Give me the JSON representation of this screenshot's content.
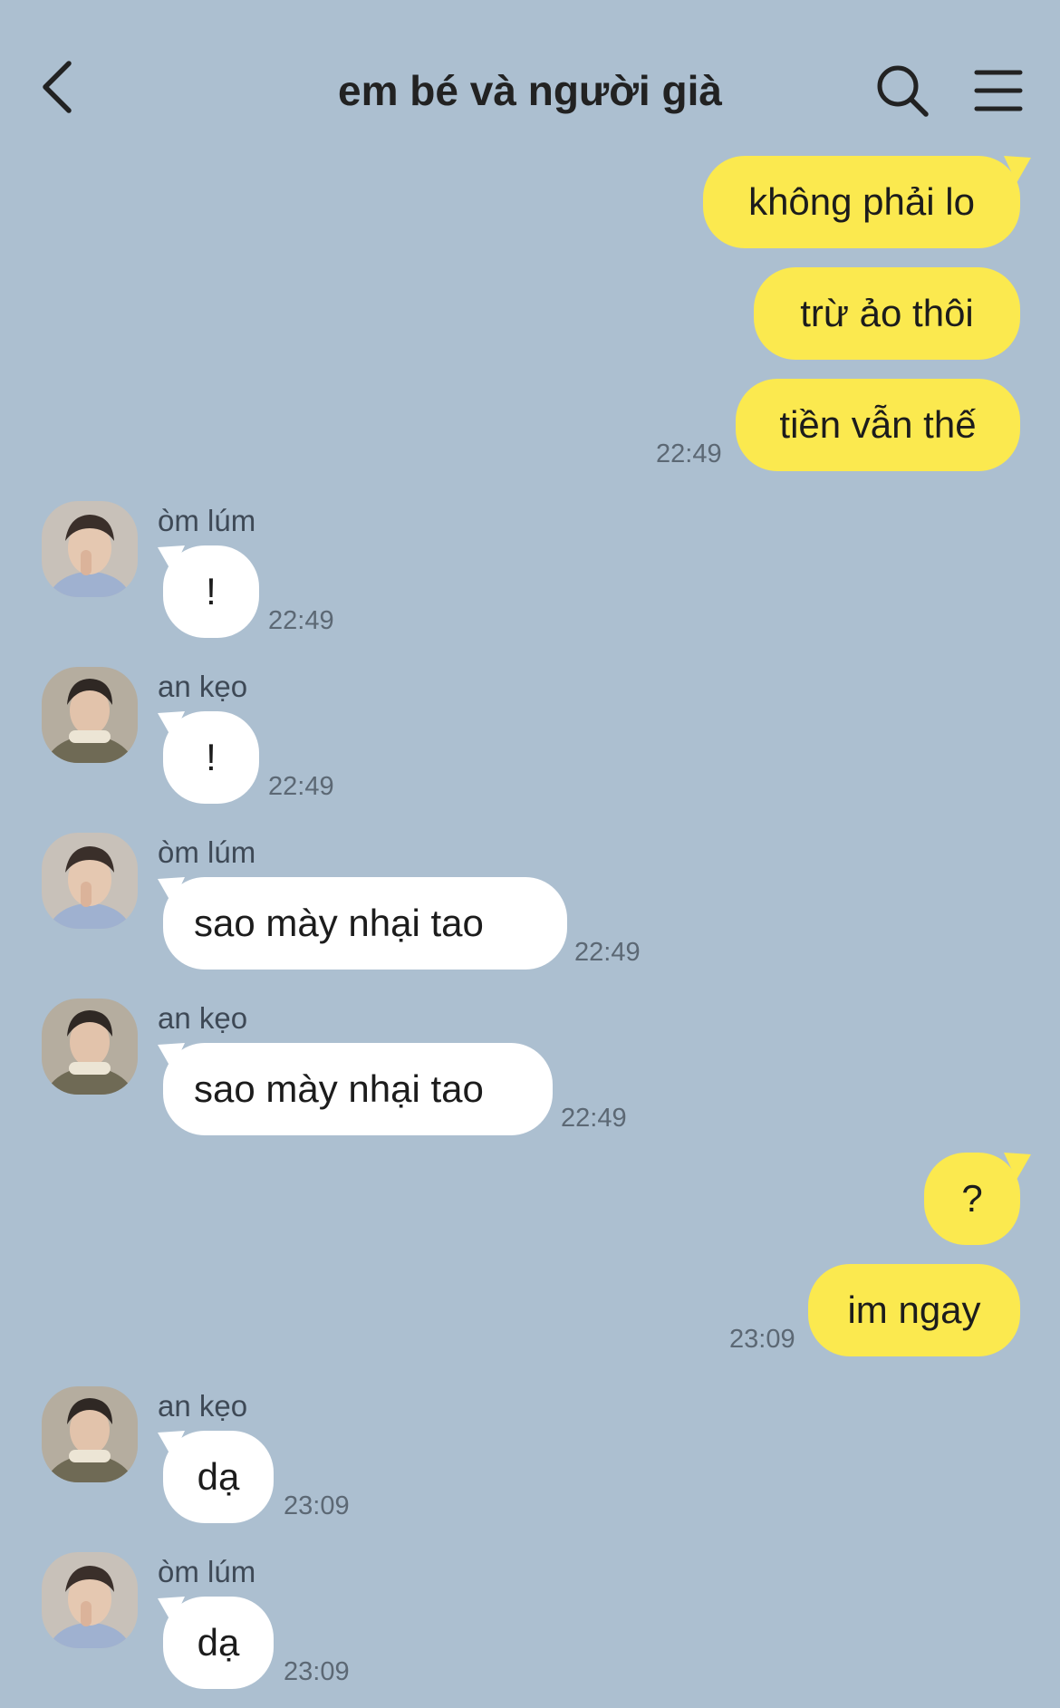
{
  "header": {
    "title": "em bé và người già",
    "back_icon": "chevron-left-icon",
    "search_icon": "search-icon",
    "menu_icon": "hamburger-menu-icon"
  },
  "colors": {
    "background": "#acbfd0",
    "outgoing_bubble": "#fbe94f",
    "incoming_bubble": "#ffffff"
  },
  "messages": [
    {
      "from": "me",
      "text": "không phải lo"
    },
    {
      "from": "me",
      "text": "trừ ảo thôi"
    },
    {
      "from": "me",
      "text": "tiền vẫn thế",
      "time": "22:49"
    },
    {
      "from": "other",
      "sender": "òm lúm",
      "text": "!",
      "time": "22:49"
    },
    {
      "from": "other",
      "sender": "an kẹo",
      "text": "!",
      "time": "22:49"
    },
    {
      "from": "other",
      "sender": "òm lúm",
      "text": "sao mày nhại tao",
      "time": "22:49"
    },
    {
      "from": "other",
      "sender": "an kẹo",
      "text": "sao mày nhại tao",
      "time": "22:49"
    },
    {
      "from": "me",
      "text": "?"
    },
    {
      "from": "me",
      "text": "im ngay",
      "time": "23:09"
    },
    {
      "from": "other",
      "sender": "an kẹo",
      "text": "dạ",
      "time": "23:09"
    },
    {
      "from": "other",
      "sender": "òm lúm",
      "text": "dạ",
      "time": "23:09"
    }
  ]
}
